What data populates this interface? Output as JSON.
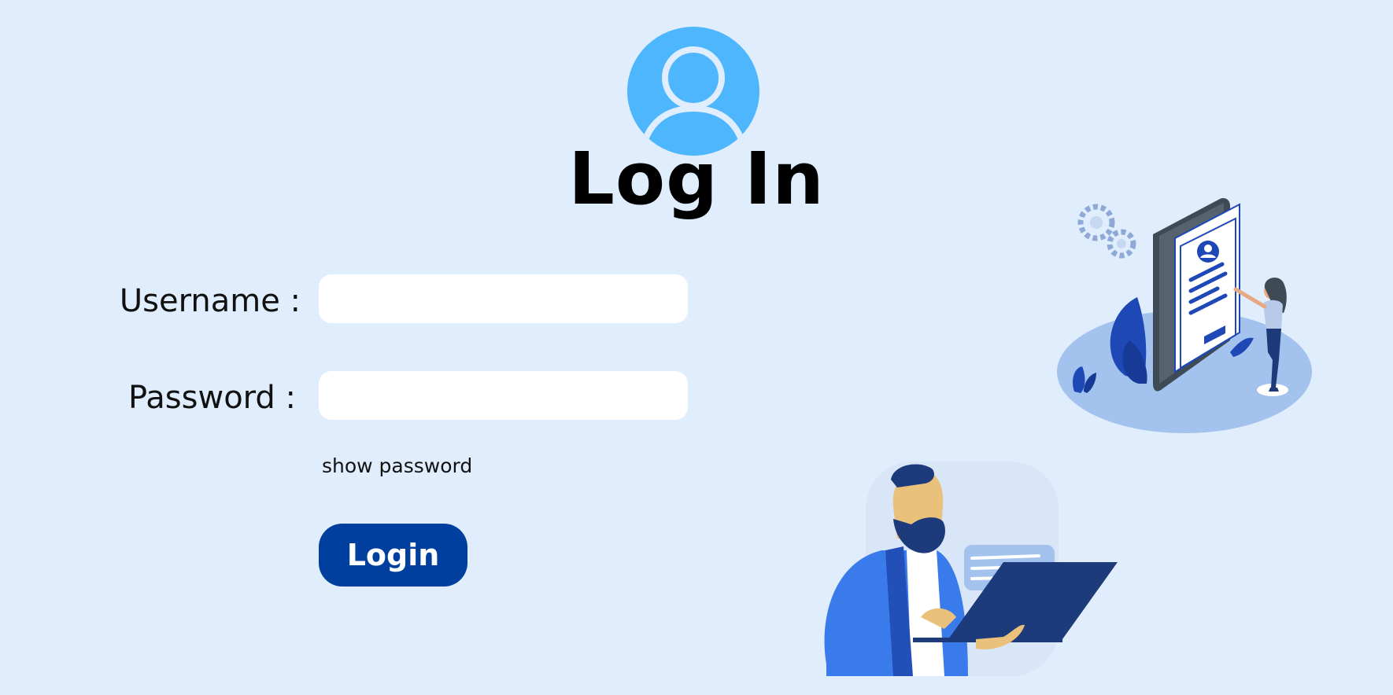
{
  "header": {
    "title": "Log In",
    "avatar_icon": "user-circle-icon"
  },
  "form": {
    "username_label": "Username :",
    "username_value": "",
    "password_label": "Password :",
    "password_value": "",
    "show_password_label": "show password",
    "login_button_label": "Login"
  },
  "illustrations": {
    "phone_profile": "phone-profile-illustration",
    "man_laptop": "man-with-laptop-illustration"
  },
  "colors": {
    "background": "#e0edfc",
    "avatar": "#4db6fd",
    "button": "#003f9e",
    "input": "#ffffff"
  }
}
